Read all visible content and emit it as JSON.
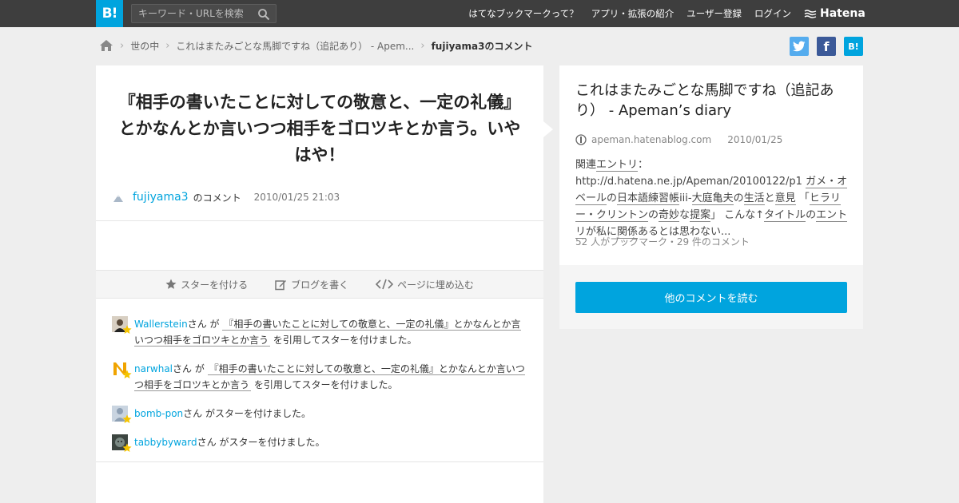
{
  "header": {
    "logo": "B!",
    "search_placeholder": "キーワード・URLを検索",
    "nav": [
      "はてなブックマークって？",
      "アプリ・拡張の紹介",
      "ユーザー登録",
      "ログイン"
    ],
    "brand": "Hatena"
  },
  "breadcrumb": {
    "items": [
      "世の中",
      "これはまたみごとな馬脚ですね（追記あり） - Apem...",
      "fujiyama3のコメント"
    ]
  },
  "social": {
    "twitter": "t",
    "facebook": "f",
    "hatena": "B!"
  },
  "comment": {
    "text": "『相手の書いたことに対しての敬意と、一定の礼儀』とかなんとか言いつつ相手をゴロツキとか言う。いやはや！",
    "author": "fujiyama3",
    "author_suffix": "のコメント",
    "date": "2010/01/25 21:03"
  },
  "actions": [
    "スターを付ける",
    "ブログを書く",
    "ページに埋め込む"
  ],
  "stars": [
    {
      "user": "Wallerstein",
      "pre": "さん が",
      "quote": "『相手の書いたことに対しての敬意と、一定の礼儀』とかなんとか言いつつ相手をゴロツキとか言う",
      "post": "を引用してスターを付けました。"
    },
    {
      "user": "narwhal",
      "pre": "さん が",
      "quote": "『相手の書いたことに対しての敬意と、一定の礼儀』とかなんとか言いつつ相手をゴロツキとか言う",
      "post": "を引用してスターを付けました。"
    },
    {
      "user": "bomb-pon",
      "pre": "さん がスターを付けました。"
    },
    {
      "user": "tabbybyward",
      "pre": "さん がスターを付けました。"
    }
  ],
  "entry": {
    "title": "これはまたみごとな馬脚ですね（追記あり） - Apeman’s diary",
    "domain": "apeman.hatenablog.com",
    "date": "2010/01/25",
    "summary": {
      "p1": "関連",
      "k1": "エントリ",
      "p2": "：http://d.hatena.ne.jp/Apeman/20100122/p1 ",
      "k2": "ガメ・オベール",
      "p3": "の",
      "k3": "日本語",
      "k4": "練習帳",
      "p4": "iii-",
      "k5": "大庭亀夫",
      "p5": "の",
      "k6": "生活",
      "p6": "と",
      "k7": "意見",
      "p7": " 「",
      "k8": "ヒラリー・クリントン",
      "p8": "の",
      "k9": "奇妙",
      "p9": "な",
      "k10": "提案",
      "p10": "」 こんな↑",
      "k11": "タイトル",
      "p11": "の",
      "k12": "エントリ",
      "p12": "が私に",
      "k13": "関係",
      "p13": "あるとは思わない..."
    },
    "stats": "52 人がブックマーク・29 件のコメント",
    "read_button": "他のコメントを読む"
  },
  "colors": {
    "accent": "#00a4de",
    "header": "#3e3e3e",
    "twitter": "#55acee",
    "facebook": "#3b5998"
  }
}
